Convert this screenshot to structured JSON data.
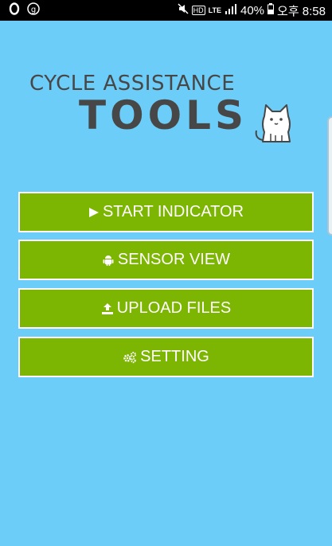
{
  "status_bar": {
    "network_badge": "HD",
    "network_type": "LTE",
    "battery": "40%",
    "time": "오후 8:58",
    "icons": [
      "opera-icon",
      "g-icon",
      "mute-icon",
      "signal-icon",
      "battery-icon"
    ]
  },
  "logo": {
    "line1": "CYCLE ASSISTANCE",
    "line2": "TOOLS",
    "text_color": "#474747"
  },
  "menu": [
    {
      "label": "START INDICATOR",
      "icon": "play-icon"
    },
    {
      "label": "SENSOR VIEW",
      "icon": "android-icon"
    },
    {
      "label": "UPLOAD FILES",
      "icon": "upload-icon"
    },
    {
      "label": "SETTING",
      "icon": "gears-icon"
    }
  ],
  "colors": {
    "background": "#6ccdf9",
    "button": "#7cb502",
    "button_border": "#ffffff"
  }
}
